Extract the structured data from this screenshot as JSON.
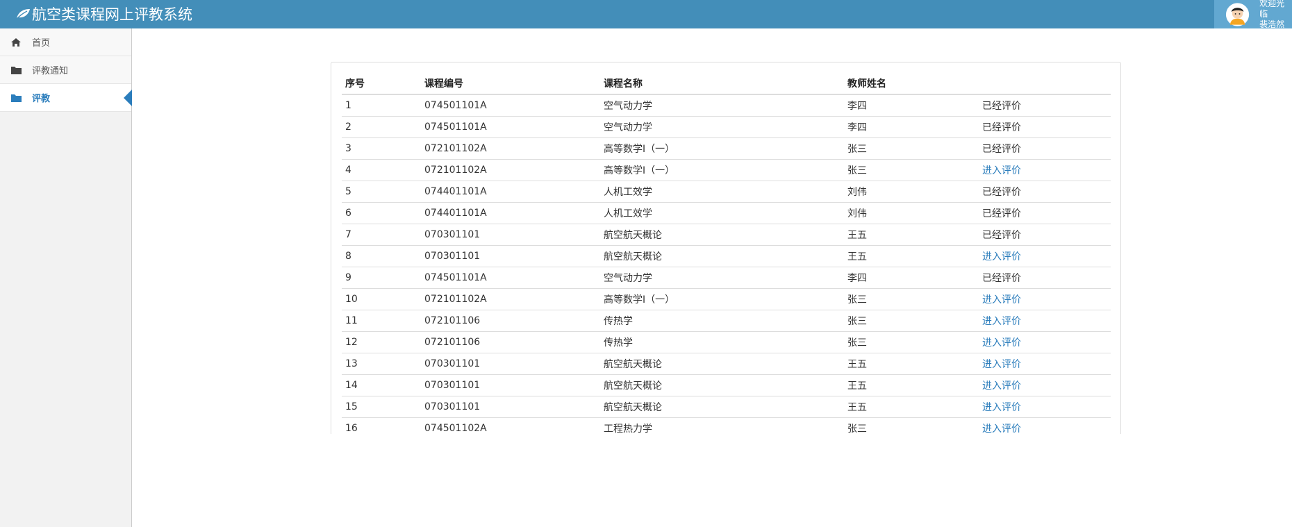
{
  "app": {
    "title": "航空类课程网上评教系统"
  },
  "user": {
    "welcome": "欢迎光临",
    "name": "裴浩然"
  },
  "sidebar": {
    "items": [
      {
        "label": "首页",
        "icon": "home-icon"
      },
      {
        "label": "评教通知",
        "icon": "folder-icon"
      },
      {
        "label": "评教",
        "icon": "folder-icon",
        "active": true
      }
    ]
  },
  "table": {
    "headers": [
      "序号",
      "课程编号",
      "课程名称",
      "教师姓名",
      ""
    ],
    "rows": [
      {
        "no": "1",
        "code": "074501101A",
        "name": "空气动力学",
        "teacher": "李四",
        "action": "已经评价",
        "link": false
      },
      {
        "no": "2",
        "code": "074501101A",
        "name": "空气动力学",
        "teacher": "李四",
        "action": "已经评价",
        "link": false
      },
      {
        "no": "3",
        "code": "072101102A",
        "name": "高等数学Ⅰ（一）",
        "teacher": "张三",
        "action": "已经评价",
        "link": false
      },
      {
        "no": "4",
        "code": "072101102A",
        "name": "高等数学Ⅰ（一）",
        "teacher": "张三",
        "action": "进入评价",
        "link": true
      },
      {
        "no": "5",
        "code": "074401101A",
        "name": "人机工效学",
        "teacher": "刘伟",
        "action": "已经评价",
        "link": false
      },
      {
        "no": "6",
        "code": "074401101A",
        "name": "人机工效学",
        "teacher": "刘伟",
        "action": "已经评价",
        "link": false
      },
      {
        "no": "7",
        "code": "070301101",
        "name": "航空航天概论",
        "teacher": "王五",
        "action": "已经评价",
        "link": false
      },
      {
        "no": "8",
        "code": "070301101",
        "name": "航空航天概论",
        "teacher": "王五",
        "action": "进入评价",
        "link": true
      },
      {
        "no": "9",
        "code": "074501101A",
        "name": "空气动力学",
        "teacher": "李四",
        "action": "已经评价",
        "link": false
      },
      {
        "no": "10",
        "code": "072101102A",
        "name": "高等数学Ⅰ（一）",
        "teacher": "张三",
        "action": "进入评价",
        "link": true
      },
      {
        "no": "11",
        "code": "072101106",
        "name": "传热学",
        "teacher": "张三",
        "action": "进入评价",
        "link": true
      },
      {
        "no": "12",
        "code": "072101106",
        "name": "传热学",
        "teacher": "张三",
        "action": "进入评价",
        "link": true
      },
      {
        "no": "13",
        "code": "070301101",
        "name": "航空航天概论",
        "teacher": "王五",
        "action": "进入评价",
        "link": true
      },
      {
        "no": "14",
        "code": "070301101",
        "name": "航空航天概论",
        "teacher": "王五",
        "action": "进入评价",
        "link": true
      },
      {
        "no": "15",
        "code": "070301101",
        "name": "航空航天概论",
        "teacher": "王五",
        "action": "进入评价",
        "link": true
      },
      {
        "no": "16",
        "code": "074501102A",
        "name": "工程热力学",
        "teacher": "张三",
        "action": "进入评价",
        "link": true
      }
    ]
  },
  "colors": {
    "header": "#438eb9",
    "user_area": "#62a8d1",
    "link": "#2b7dbc"
  }
}
